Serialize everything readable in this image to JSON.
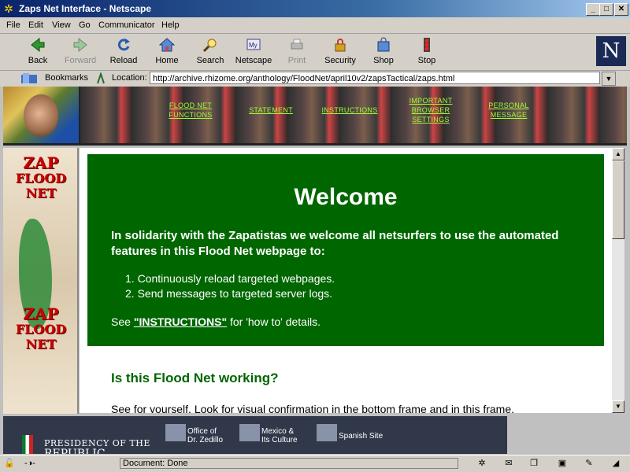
{
  "window": {
    "title": "Zaps Net Interface - Netscape",
    "min": "_",
    "max": "□",
    "close": "✕"
  },
  "menu": [
    "File",
    "Edit",
    "View",
    "Go",
    "Communicator",
    "Help"
  ],
  "toolbar": {
    "back": "Back",
    "forward": "Forward",
    "reload": "Reload",
    "home": "Home",
    "search": "Search",
    "netscape": "Netscape",
    "print": "Print",
    "security": "Security",
    "shop": "Shop",
    "stop": "Stop"
  },
  "location": {
    "bookmarks": "Bookmarks",
    "label": "Location:",
    "url": "http://archive.rhizome.org/anthology/FloodNet/april10v2/zapsTactical/zaps.html"
  },
  "top_nav": {
    "functions": [
      "FLOOD NET",
      "FUNCTIONS"
    ],
    "statement": "STATEMENT",
    "instructions": "INSTRUCTIONS",
    "settings": [
      "IMPORTANT",
      "BROWSER",
      "SETTINGS"
    ],
    "message": [
      "PERSONAL",
      "MESSAGE"
    ]
  },
  "left": {
    "zap1": [
      "ZAP",
      "FLOOD",
      "NET"
    ],
    "zap2": [
      "ZAP",
      "FLOOD",
      "NET"
    ]
  },
  "main": {
    "welcome_title": "Welcome",
    "intro": "In solidarity with the Zapatistas we welcome all netsurfers to use the automated features in this Flood Net webpage to:",
    "list": [
      "1.  Continuously reload targeted webpages.",
      "2.  Send messages to targeted server logs."
    ],
    "see_prefix": "See ",
    "see_link": "\"INSTRUCTIONS\"",
    "see_suffix": " for 'how to' details.",
    "question": "Is this Flood Net working?",
    "see_yourself": "See for yourself. Look for visual confirmation in the bottom frame and in this frame."
  },
  "bottom": {
    "presidency": "PRESIDENCY OF THE",
    "republic": "REPUBLIC",
    "office": [
      "Office of",
      "Dr. Zedillo"
    ],
    "mexico": [
      "Mexico &",
      "Its Culture"
    ],
    "spanish": "Spanish Site"
  },
  "status": {
    "text": "Document: Done"
  }
}
